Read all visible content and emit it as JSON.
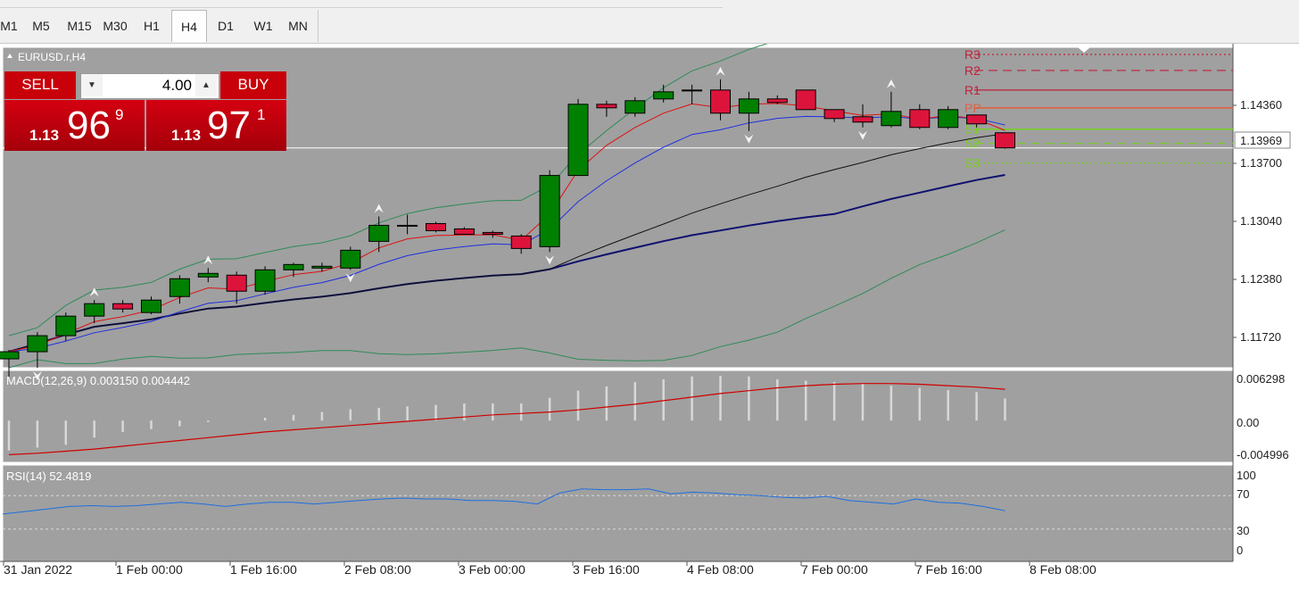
{
  "timeframes": [
    "M1",
    "M5",
    "M15",
    "M30",
    "H1",
    "H4",
    "D1",
    "W1",
    "MN"
  ],
  "active_timeframe": "H4",
  "chart": {
    "symbol_label": "EURUSD.r,H4",
    "bg_color": "#a0a0a0",
    "bull_color": "#008000",
    "bear_color": "#dc143c",
    "price_axis": [
      "1.14360",
      "1.13700",
      "1.13040",
      "1.12380",
      "1.11720"
    ],
    "current_price": "1.13969",
    "pivot_labels": [
      "R3",
      "R2",
      "R1",
      "PP",
      "S1",
      "S2",
      "S3"
    ],
    "time_axis": [
      "31 Jan 2022",
      "1 Feb 00:00",
      "1 Feb 16:00",
      "2 Feb 08:00",
      "3 Feb 00:00",
      "3 Feb 16:00",
      "4 Feb 08:00",
      "7 Feb 00:00",
      "7 Feb 16:00",
      "8 Feb 08:00"
    ]
  },
  "trade": {
    "sell_label": "SELL",
    "buy_label": "BUY",
    "volume": "4.00",
    "sell_small": "1.13",
    "sell_big": "96",
    "sell_sup": "9",
    "buy_small": "1.13",
    "buy_big": "97",
    "buy_sup": "1"
  },
  "macd": {
    "label": "MACD(12,26,9) 0.003150 0.004442",
    "axis": [
      "0.006298",
      "0.00",
      "-0.004996"
    ]
  },
  "rsi": {
    "label": "RSI(14) 52.4819",
    "axis": [
      "100",
      "70",
      "30",
      "0"
    ]
  },
  "chart_data": {
    "type": "candlestick",
    "symbol": "EURUSD.r",
    "timeframe": "H4",
    "candles": [
      {
        "o": 1.116,
        "h": 1.117,
        "l": 1.114,
        "c": 1.1168
      },
      {
        "o": 1.1168,
        "h": 1.119,
        "l": 1.115,
        "c": 1.1186
      },
      {
        "o": 1.1186,
        "h": 1.1212,
        "l": 1.118,
        "c": 1.1208
      },
      {
        "o": 1.1208,
        "h": 1.1226,
        "l": 1.12,
        "c": 1.1222
      },
      {
        "o": 1.1222,
        "h": 1.1226,
        "l": 1.1212,
        "c": 1.1216
      },
      {
        "o": 1.1212,
        "h": 1.123,
        "l": 1.121,
        "c": 1.1226
      },
      {
        "o": 1.123,
        "h": 1.1254,
        "l": 1.1222,
        "c": 1.125
      },
      {
        "o": 1.1252,
        "h": 1.1262,
        "l": 1.1246,
        "c": 1.1256
      },
      {
        "o": 1.1254,
        "h": 1.1258,
        "l": 1.1222,
        "c": 1.1236
      },
      {
        "o": 1.1236,
        "h": 1.1264,
        "l": 1.1232,
        "c": 1.126
      },
      {
        "o": 1.126,
        "h": 1.1268,
        "l": 1.1252,
        "c": 1.1266
      },
      {
        "o": 1.1262,
        "h": 1.1268,
        "l": 1.1258,
        "c": 1.1264
      },
      {
        "o": 1.1262,
        "h": 1.1286,
        "l": 1.126,
        "c": 1.1282
      },
      {
        "o": 1.1292,
        "h": 1.132,
        "l": 1.128,
        "c": 1.131
      },
      {
        "o": 1.131,
        "h": 1.1322,
        "l": 1.13,
        "c": 1.131
      },
      {
        "o": 1.1312,
        "h": 1.1314,
        "l": 1.1302,
        "c": 1.1304
      },
      {
        "o": 1.1306,
        "h": 1.1308,
        "l": 1.13,
        "c": 1.13
      },
      {
        "o": 1.1302,
        "h": 1.1304,
        "l": 1.1296,
        "c": 1.13
      },
      {
        "o": 1.1298,
        "h": 1.13,
        "l": 1.1278,
        "c": 1.1284
      },
      {
        "o": 1.1286,
        "h": 1.1372,
        "l": 1.128,
        "c": 1.1366
      },
      {
        "o": 1.1366,
        "h": 1.1452,
        "l": 1.1366,
        "c": 1.1446
      },
      {
        "o": 1.1446,
        "h": 1.145,
        "l": 1.1432,
        "c": 1.1442
      },
      {
        "o": 1.1436,
        "h": 1.1454,
        "l": 1.1432,
        "c": 1.145
      },
      {
        "o": 1.1452,
        "h": 1.1468,
        "l": 1.1448,
        "c": 1.146
      },
      {
        "o": 1.1462,
        "h": 1.1468,
        "l": 1.1446,
        "c": 1.1462
      },
      {
        "o": 1.1462,
        "h": 1.1474,
        "l": 1.1428,
        "c": 1.1436
      },
      {
        "o": 1.1436,
        "h": 1.146,
        "l": 1.1416,
        "c": 1.1452
      },
      {
        "o": 1.1452,
        "h": 1.1456,
        "l": 1.1446,
        "c": 1.1448
      },
      {
        "o": 1.1462,
        "h": 1.1462,
        "l": 1.144,
        "c": 1.144
      },
      {
        "o": 1.144,
        "h": 1.144,
        "l": 1.1426,
        "c": 1.143
      },
      {
        "o": 1.1432,
        "h": 1.1446,
        "l": 1.142,
        "c": 1.1426
      },
      {
        "o": 1.1422,
        "h": 1.146,
        "l": 1.142,
        "c": 1.1438
      },
      {
        "o": 1.144,
        "h": 1.1446,
        "l": 1.1418,
        "c": 1.142
      },
      {
        "o": 1.142,
        "h": 1.1444,
        "l": 1.1418,
        "c": 1.144
      },
      {
        "o": 1.1434,
        "h": 1.1434,
        "l": 1.142,
        "c": 1.1424
      },
      {
        "o": 1.1414,
        "h": 1.1414,
        "l": 1.1396,
        "c": 1.1397
      }
    ],
    "pivots": {
      "R3": 1.1502,
      "R2": 1.1484,
      "R1": 1.1462,
      "PP": 1.1442,
      "S1": 1.1418,
      "S2": 1.1402,
      "S3": 1.138
    },
    "current_price": 1.13969,
    "price_range": [
      1.115,
      1.151
    ],
    "macd_histogram": [
      -0.0042,
      -0.0038,
      -0.0034,
      -0.0024,
      -0.0016,
      -0.0012,
      -0.0008,
      -0.0002,
      0.0,
      0.0004,
      0.0008,
      0.0012,
      0.0016,
      0.0018,
      0.002,
      0.0022,
      0.0024,
      0.0024,
      0.0024,
      0.0032,
      0.0042,
      0.0048,
      0.0054,
      0.0058,
      0.0062,
      0.0063,
      0.0062,
      0.0058,
      0.0056,
      0.0054,
      0.0052,
      0.0049,
      0.0046,
      0.0043,
      0.004,
      0.0031
    ],
    "macd_signal": [
      -0.0048,
      -0.0046,
      -0.0043,
      -0.004,
      -0.0036,
      -0.0032,
      -0.0028,
      -0.0024,
      -0.002,
      -0.0016,
      -0.0013,
      -0.001,
      -0.0007,
      -0.0004,
      -0.0001,
      0.0002,
      0.0005,
      0.0008,
      0.001,
      0.0012,
      0.0015,
      0.0019,
      0.0023,
      0.0028,
      0.0033,
      0.0038,
      0.0042,
      0.0046,
      0.0049,
      0.0051,
      0.0052,
      0.0052,
      0.0051,
      0.0049,
      0.0047,
      0.0044
    ],
    "macd_range": [
      -0.004996,
      0.006298
    ],
    "rsi": [
      48,
      51,
      54,
      57,
      58,
      57,
      58,
      60,
      62,
      60,
      57,
      60,
      62,
      62,
      60,
      62,
      64,
      66,
      67,
      66,
      66,
      64,
      64,
      63,
      60,
      73,
      78,
      77,
      77,
      78,
      72,
      74,
      73,
      71,
      70,
      68,
      67,
      69,
      64,
      62,
      60,
      66,
      62,
      61,
      57,
      52
    ],
    "rsi_levels": [
      70,
      30
    ],
    "rsi_range": [
      0,
      100
    ]
  }
}
